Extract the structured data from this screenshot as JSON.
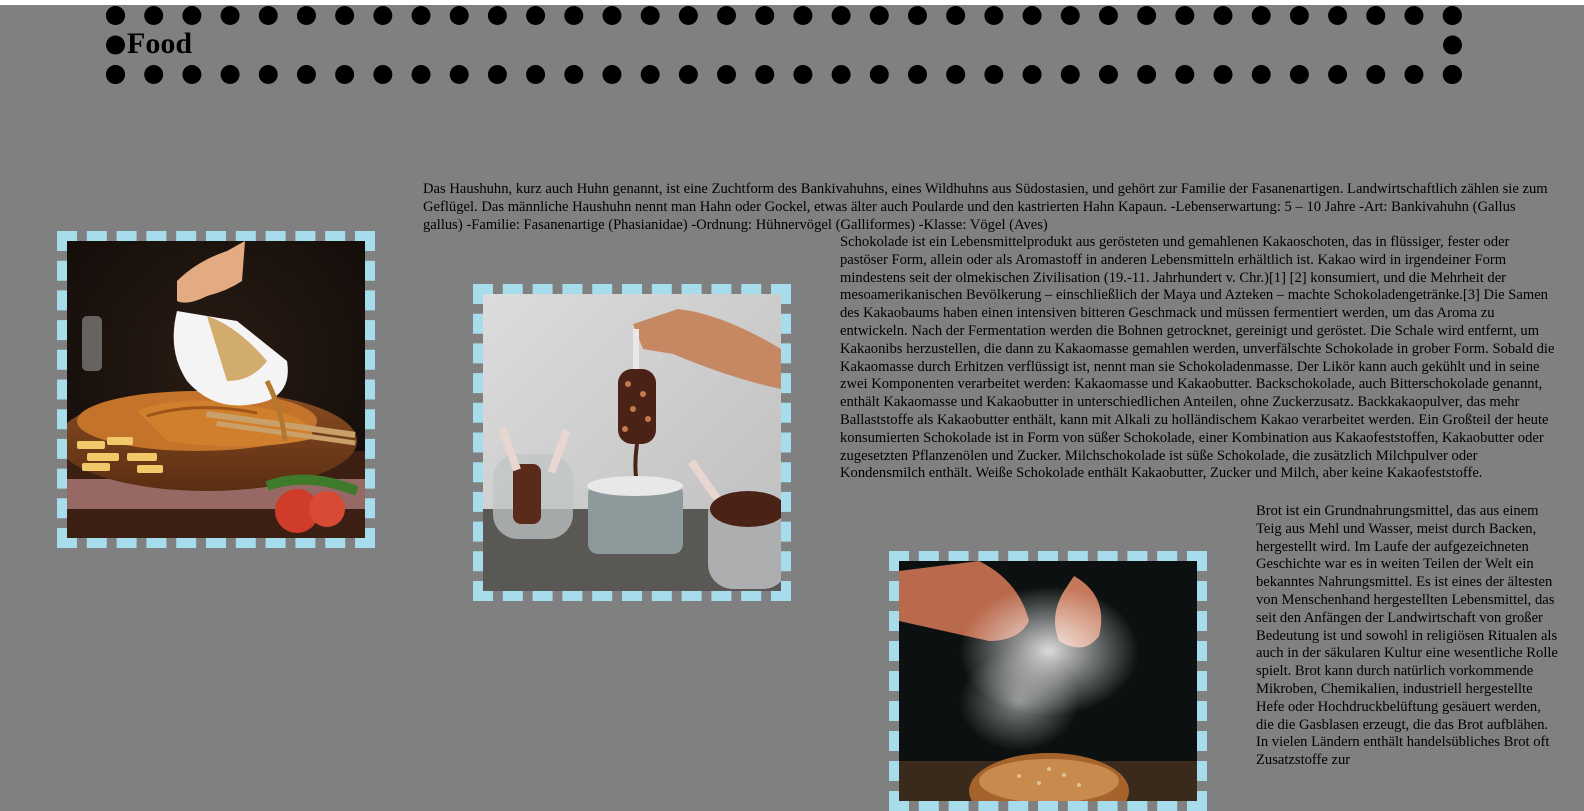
{
  "header": {
    "title": "Food"
  },
  "articles": [
    {
      "id": "chicken",
      "image_alt": "Plate of breaded chicken schnitzel with gravy being poured from a white gravy boat, fries and tomatoes",
      "text": "Das Haushuhn, kurz auch Huhn genannt, ist eine Zuchtform des Bankivahuhns, eines Wildhuhns aus Südostasien, und gehört zur Familie der Fasanenartigen. Landwirtschaftlich zählen sie zum Geflügel. Das männliche Haushuhn nennt man Hahn oder Gockel, etwas älter auch Poularde und den kastrierten Hahn Kapaun. -Lebenserwartung: 5 – 10 Jahre -Art: Bankivahuhn (Gallus gallus) -Familie: Fasanenartige (Phasianidae) -Ordnung: Hühnervögel (Galliformes) -Klasse: Vögel (Aves)"
    },
    {
      "id": "chocolate",
      "image_alt": "Hand dipping a chocolate ice pop into melted chocolate, glasses of chocolate pops around",
      "text": "Schokolade ist ein Lebensmittelprodukt aus gerösteten und gemahlenen Kakaoschoten, das in flüssiger, fester oder pastöser Form, allein oder als Aromastoff in anderen Lebensmitteln erhältlich ist. Kakao wird in irgendeiner Form mindestens seit der olmekischen Zivilisation (19.-11. Jahrhundert v. Chr.)[1] [2] konsumiert, und die Mehrheit der mesoamerikanischen Bevölkerung – einschließlich der Maya und Azteken – machte Schokoladengetränke.[3] Die Samen des Kakaobaums haben einen intensiven bitteren Geschmack und müssen fermentiert werden, um das Aroma zu entwickeln. Nach der Fermentation werden die Bohnen getrocknet, gereinigt und geröstet. Die Schale wird entfernt, um Kakaonibs herzustellen, die dann zu Kakaomasse gemahlen werden, unverfälschte Schokolade in grober Form. Sobald die Kakaomasse durch Erhitzen verflüssigt ist, nennt man sie Schokoladenmasse. Der Likör kann auch gekühlt und in seine zwei Komponenten verarbeitet werden: Kakaomasse und Kakaobutter. Backschokolade, auch Bitterschokolade genannt, enthält Kakaomasse und Kakaobutter in unterschiedlichen Anteilen, ohne Zuckerzusatz. Backkakaopulver, das mehr Ballaststoffe als Kakaobutter enthält, kann mit Alkali zu holländischem Kakao verarbeitet werden. Ein Großteil der heute konsumierten Schokolade ist in Form von süßer Schokolade, einer Kombination aus Kakaofeststoffen, Kakaobutter oder zugesetzten Pflanzenölen und Zucker. Milchschokolade ist süße Schokolade, die zusätzlich Milchpulver oder Kondensmilch enthält. Weiße Schokolade enthält Kakaobutter, Zucker und Milch, aber keine Kakaofeststoffe."
    },
    {
      "id": "bread",
      "image_alt": "Hands clapping flour above a round loaf of bread on a wooden board, dark background",
      "text": "Brot ist ein Grundnahrungsmittel, das aus einem Teig aus Mehl und Wasser, meist durch Backen, hergestellt wird. Im Laufe der aufgezeichneten Geschichte war es in weiten Teilen der Welt ein bekanntes Nahrungsmittel. Es ist eines der ältesten von Menschenhand hergestellten Lebensmittel, das seit den Anfängen der Landwirtschaft von großer Bedeutung ist und sowohl in religiösen Ritualen als auch in der säkularen Kultur eine wesentliche Rolle spielt. Brot kann durch natürlich vorkommende Mikroben, Chemikalien, industriell hergestellte Hefe oder Hochdruckbelüftung gesäuert werden, die die Gasblasen erzeugt, die das Brot aufblähen. In vielen Ländern enthält handelsübliches Brot oft Zusatzstoffe zur"
    }
  ],
  "colors": {
    "background": "#808080",
    "frame_border": "#a6dcec",
    "header_dots": "#000000"
  }
}
